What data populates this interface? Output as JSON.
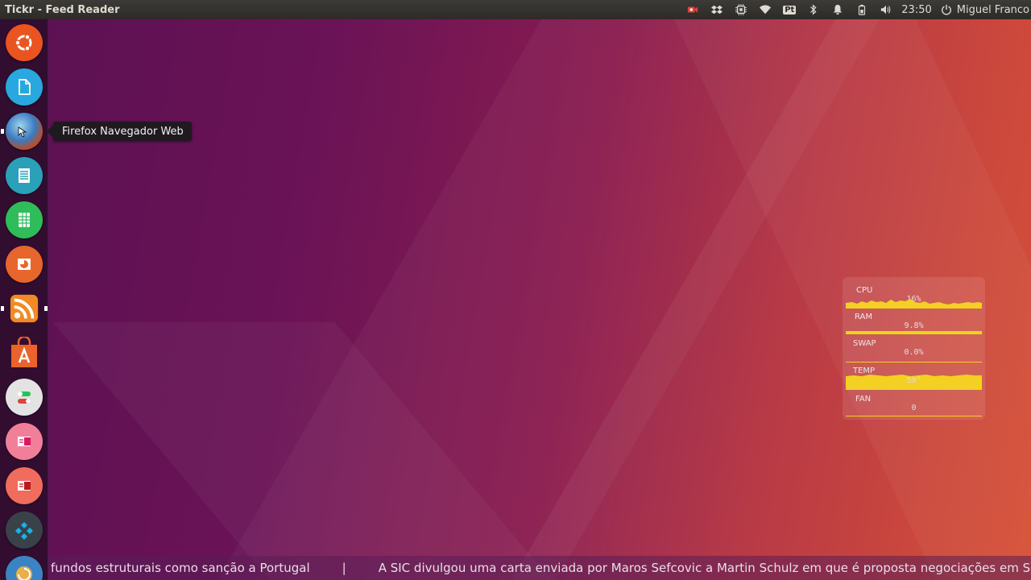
{
  "top_panel": {
    "window_title": "Tickr - Feed Reader",
    "clock": "23:50",
    "user_name": "Miguel Franco",
    "indicators": [
      "camera-icon",
      "dropbox-icon",
      "system-monitor-icon",
      "wifi-icon",
      "keyboard-layout-icon",
      "bluetooth-icon",
      "notification-bell-icon",
      "battery-icon",
      "volume-icon",
      "power-icon"
    ],
    "keyboard_layout": "Pt"
  },
  "launcher": {
    "items": [
      {
        "name": "ubuntu-dash",
        "icon": "ubuntu-logo-icon",
        "color": "#e95420"
      },
      {
        "name": "files",
        "icon": "document-icon",
        "color": "#29a8e0"
      },
      {
        "name": "firefox",
        "icon": "firefox-icon",
        "color": "#3a7bbf"
      },
      {
        "name": "libreoffice-writer",
        "icon": "writer-icon",
        "color": "#2aa1b8"
      },
      {
        "name": "libreoffice-calc",
        "icon": "calc-icon",
        "color": "#2ebd59"
      },
      {
        "name": "libreoffice-impress",
        "icon": "impress-icon",
        "color": "#e6662c"
      },
      {
        "name": "tickr",
        "icon": "rss-feed-icon",
        "color": "#f08a24"
      },
      {
        "name": "ubuntu-software",
        "icon": "software-center-icon",
        "color": "#e8642c"
      },
      {
        "name": "system-settings",
        "icon": "toggle-switches-icon",
        "color": "#e3e3e3"
      },
      {
        "name": "app-pink",
        "icon": "slides-icon",
        "color": "#f0809a"
      },
      {
        "name": "app-red",
        "icon": "slides-icon",
        "color": "#f06c5c"
      },
      {
        "name": "kodi",
        "icon": "kodi-icon",
        "color": "#394249"
      },
      {
        "name": "app-bottom",
        "icon": "swirl-icon",
        "color": "#e8b04a"
      }
    ],
    "tooltip": "Firefox Navegador Web"
  },
  "sysmon": {
    "rows": [
      {
        "label": "CPU",
        "value": "16%"
      },
      {
        "label": "RAM",
        "value": "9.8%"
      },
      {
        "label": "SWAP",
        "value": "0.0%"
      },
      {
        "label": "TEMP",
        "value": "59°"
      },
      {
        "label": "FAN",
        "value": "0"
      }
    ],
    "bar_color": "#f3d021"
  },
  "ticker": {
    "items": [
      "fundos estruturais como sanção a Portugal",
      "A SIC divulgou uma carta enviada por Maros Sefcovic a Martin Schulz  em que é proposta negociações em S"
    ],
    "separator": "|"
  }
}
